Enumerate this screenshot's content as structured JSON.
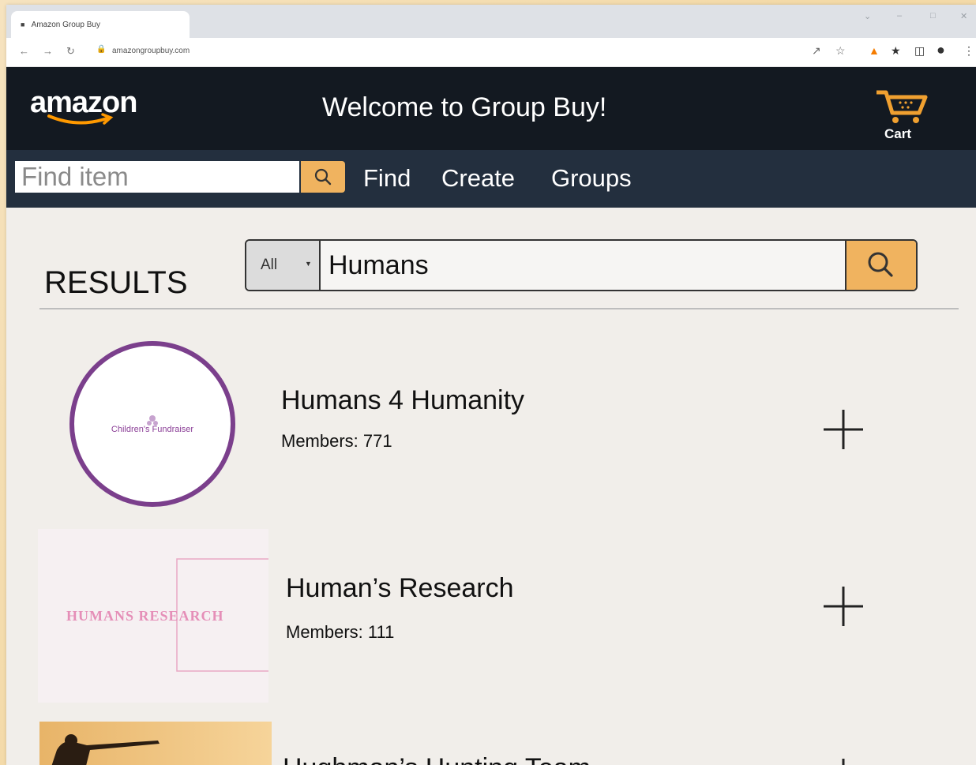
{
  "browser": {
    "tab_title": "Amazon Group Buy",
    "url": "amazongroupbuy.com"
  },
  "header": {
    "logo": "amazon",
    "welcome": "Welcome to Group Buy!",
    "cart_label": "Cart"
  },
  "nav": {
    "search_placeholder": "Find item",
    "links": [
      "Find",
      "Create",
      "Groups"
    ]
  },
  "results": {
    "title": "RESULTS",
    "category": "All",
    "query": "Humans",
    "items": [
      {
        "name": "Humans 4 Humanity",
        "members": "Members: 771",
        "thumb_text": "Children's Fundraiser"
      },
      {
        "name": "Human’s Research",
        "members": "Members: 111",
        "thumb_text": "HUMANS RESEARCH"
      },
      {
        "name": "Hughman’s Hunting Team",
        "members": "",
        "thumb_text": ""
      }
    ]
  },
  "colors": {
    "header_bg": "#131921",
    "subnav_bg": "#232f3e",
    "accent": "#f0b35f",
    "page_bg": "#f1eeea",
    "fundraiser_purple": "#7b3f8c",
    "research_pink": "#e58fb8"
  },
  "icons": {
    "search": "search-icon",
    "cart": "cart-icon",
    "add": "plus-icon"
  }
}
